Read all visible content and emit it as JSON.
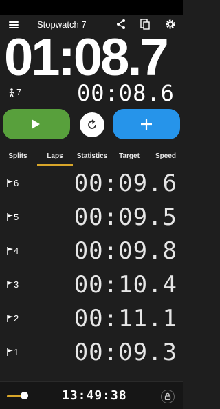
{
  "toolbar": {
    "title": "Stopwatch 7",
    "icons": [
      "menu-icon",
      "share-icon",
      "pdf-export-icon",
      "gear-icon"
    ]
  },
  "main_time": "01:08.7",
  "lap_count": "7",
  "current_lap_time": "00:08.6",
  "buttons": {
    "play": "play-icon",
    "reset": "reset-icon",
    "add_lap": "plus-icon"
  },
  "colors": {
    "play": "#58a03c",
    "add": "#2694ea",
    "accent": "#d8a62a",
    "background": "#1e1e1e"
  },
  "tabs": [
    {
      "label": "Splits"
    },
    {
      "label": "Laps",
      "selected": true
    },
    {
      "label": "Statistics"
    },
    {
      "label": "Target"
    },
    {
      "label": "Speed"
    }
  ],
  "laps": [
    {
      "number": "6",
      "time": "00:09.6"
    },
    {
      "number": "5",
      "time": "00:09.5"
    },
    {
      "number": "4",
      "time": "00:09.8"
    },
    {
      "number": "3",
      "time": "00:10.4"
    },
    {
      "number": "2",
      "time": "00:11.1"
    },
    {
      "number": "1",
      "time": "00:09.3"
    }
  ],
  "bottom": {
    "clock": "13:49:38"
  }
}
